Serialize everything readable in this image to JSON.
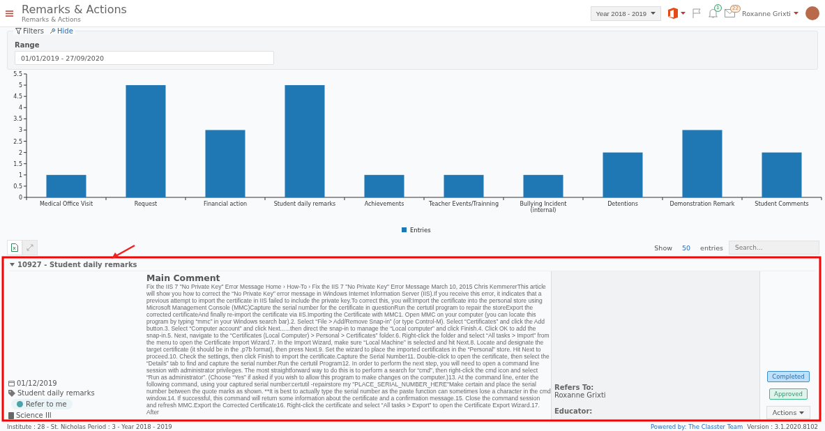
{
  "header": {
    "title": "Remarks & Actions",
    "breadcrumb": "Remarks & Actions",
    "year": "Year 2018 - 2019",
    "notifications": "1",
    "messages": "22",
    "user": "Roxanne Grixti"
  },
  "filters": {
    "label": "Filters",
    "hide": "Hide",
    "range_label": "Range",
    "range_value": "01/01/2019 - 27/09/2020"
  },
  "chart_data": {
    "type": "bar",
    "categories": [
      "Medical Office Visit",
      "Request",
      "Financial action",
      "Student daily remarks",
      "Achievements",
      "Teacher Events/Trainning",
      "Bullying Incident (internal)",
      "Detentions",
      "Demonstration Remark",
      "Student Comments"
    ],
    "series": [
      {
        "name": "Entries",
        "color": "#1f77b4",
        "values": [
          1,
          5,
          3,
          5,
          1,
          1,
          1,
          2,
          3,
          2
        ]
      }
    ],
    "ylim": [
      0,
      5.5
    ],
    "yticks": [
      0,
      0.5,
      1,
      1.5,
      2,
      2.5,
      3,
      3.5,
      4,
      4.5,
      5,
      5.5
    ]
  },
  "table": {
    "show_label": "Show",
    "page_size": "50",
    "entries_label": "entries",
    "search_placeholder": "Search...",
    "group": {
      "title": "10927 - Student daily remarks",
      "expanded": true
    },
    "record": {
      "date": "01/12/2019",
      "category": "Student daily remarks",
      "refer_button": "Refer to me",
      "subject": "Science III",
      "comment_title": "Main Comment",
      "comment": "Fix the IIS 7 \"No Private Key\" Error Message Home › How-To › Fix the IIS 7 \"No Private Key\" Error Message March 10, 2015 Chris KemmererThis article will show you how to correct the “No Private Key” error message in Windows Internet Information Server (IIS).If you receive this error, it indicates that a previous attempt to import the certificate in IIS failed to include the private key.To correct this, you will:Import the certificate into the personal store using Microsoft Management Console (MMC)Capture the serial number for the certificate in questionRun the certutil program to repair the storeExport the corrected certificateAnd finally re-import the certificate via IIS.Importing the Certificate with MMC1. Open MMC on your computer (you can locate this program by typing “mmc” in your Windows search bar).2. Select “File > Add/Remove Snap-in” (or type Control-M). Select “Certificates” and click the Add button.3. Select “Computer account” and click Next......then direct the snap-in to manage the “Local computer” and click Finish.4. Click OK to add the snap-in.5. Next, navigate to the “Certificates (Local Computer) > Personal > Certificates” folder.6. Right-click the folder and select “All tasks > Import” from the menu to open the Certificate Import Wizard.7. In the Import Wizard, make sure “Local Machine” is selected and hit Next.8. Locate and designate the target certificate (it should be in the .p7b format), then press Next.9. Set the wizard to place the imported certificates in the “Personal” store. Hit Next to proceed.10. Check the settings, then click Finish to import the certificate.Capture the Serial Number11. Double-click to open the certificate, then select the “Details” tab to find and capture the serial number.Run the certutil Program12. In order to perform the next step, you will need to open a command line session with administrator privileges. The most straightforward way to do this is to perform a search for “cmd”, then right-click the cmd icon and select “Run as administrator”. (Choose “Yes” if asked if you wish to allow this program to make changes on the computer.)13. At the command line, enter the following command, using your captured serial number:certutil -repairstore my \"PLACE_SERIAL_NUMBER_HERE\"Make certain and place the serial number between the quote marks as shown.  **It is best to actually type the serial number as the paste function can sometimes lose a character in the cmd window.14. If successful, this command will return some information about the certificate and a confirmation message.15. Close the command session and refresh MMC.Export the Corrected Certificate16. Right-click the certificate and select “All tasks > Export” to open the Certificate Export Wizard.17. After",
      "refers_label": "Refers To:",
      "refers_value": "Roxanne Grixti",
      "educator_label": "Educator:",
      "statuses": [
        {
          "label": "Completed",
          "kind": "info"
        },
        {
          "label": "Approved",
          "kind": "success"
        }
      ],
      "actions": "Actions"
    }
  },
  "footer": {
    "institute": "Institute : 28 - St. Nicholas Period : 3 - Year 2018 - 2019",
    "powered": "Powered by: The Classter Team",
    "version": "Version : 3.1.2020.8102"
  }
}
